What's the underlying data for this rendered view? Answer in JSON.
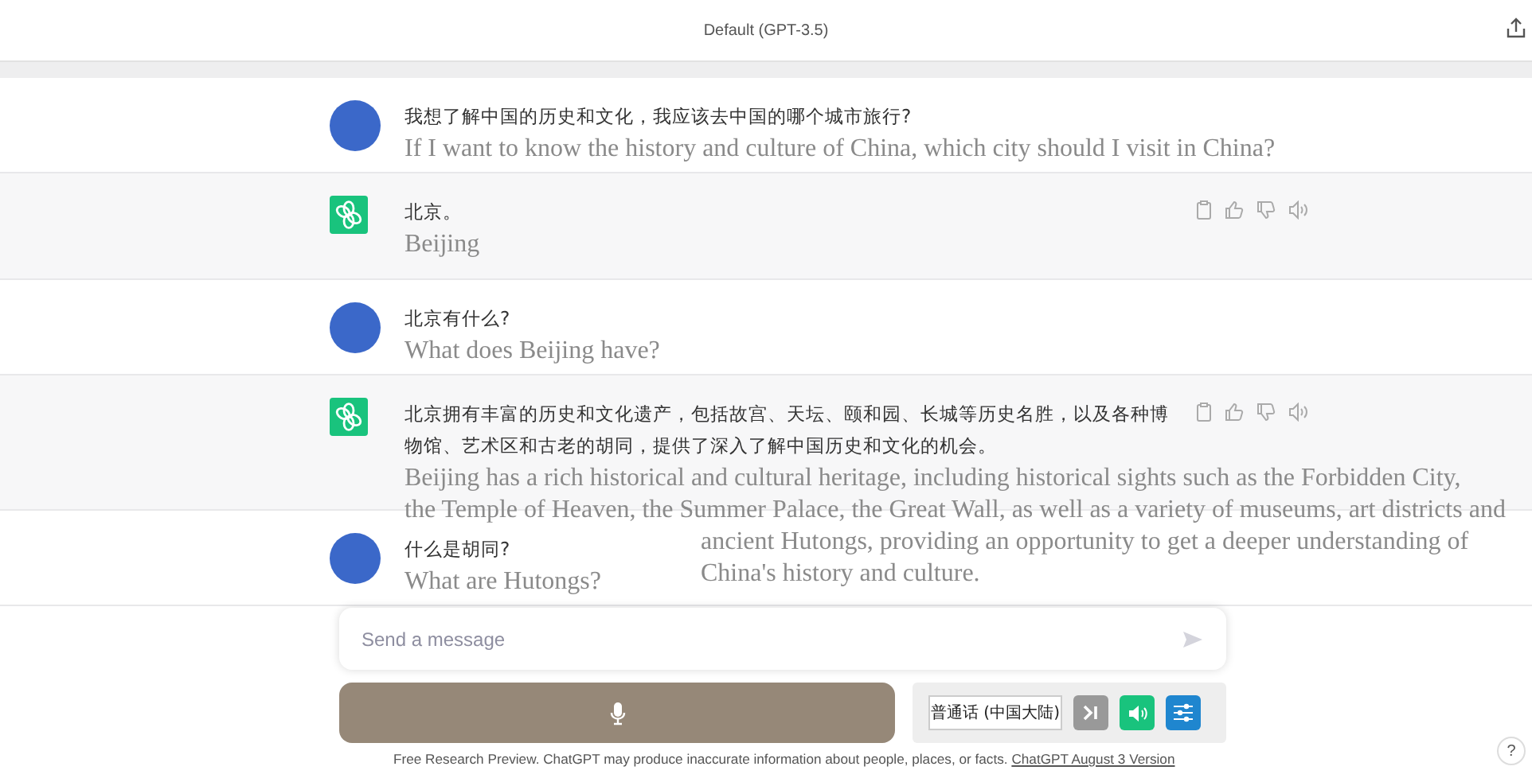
{
  "header": {
    "title": "Default (GPT-3.5)"
  },
  "messages": [
    {
      "kind": "user",
      "text": "我想了解中国的历史和文化，我应该去中国的哪个城市旅行?",
      "translation": [
        "If I want to know the history and culture of China, which city should I visit in China?"
      ]
    },
    {
      "kind": "assistant",
      "text": "北京。",
      "translation": [
        "Beijing"
      ]
    },
    {
      "kind": "user",
      "text": "北京有什么?",
      "translation": [
        "What does Beijing have?"
      ]
    },
    {
      "kind": "assistant",
      "text": "北京拥有丰富的历史和文化遗产，包括故宫、天坛、颐和园、长城等历史名胜，以及各种博物馆、艺术区和古老的胡同，提供了深入了解中国历史和文化的机会。",
      "translation": [
        "Beijing has a rich historical and cultural heritage, including historical sights such as the Forbidden City,",
        "the Temple of Heaven, the Summer Palace, the Great Wall, as well as a variety of museums, art districts and"
      ],
      "translation_overflow": [
        "ancient Hutongs, providing an opportunity to get a deeper understanding of",
        "China's history and culture."
      ]
    },
    {
      "kind": "user",
      "text": "什么是胡同?",
      "translation": [
        "What are Hutongs?"
      ]
    }
  ],
  "composer": {
    "placeholder": "Send a message"
  },
  "voice_controls": {
    "language": "普通话 (中国大陆)"
  },
  "footer": {
    "text": "Free Research Preview. ChatGPT may produce inaccurate information about people, places, or facts.",
    "link": "ChatGPT August 3 Version"
  },
  "help": "?"
}
